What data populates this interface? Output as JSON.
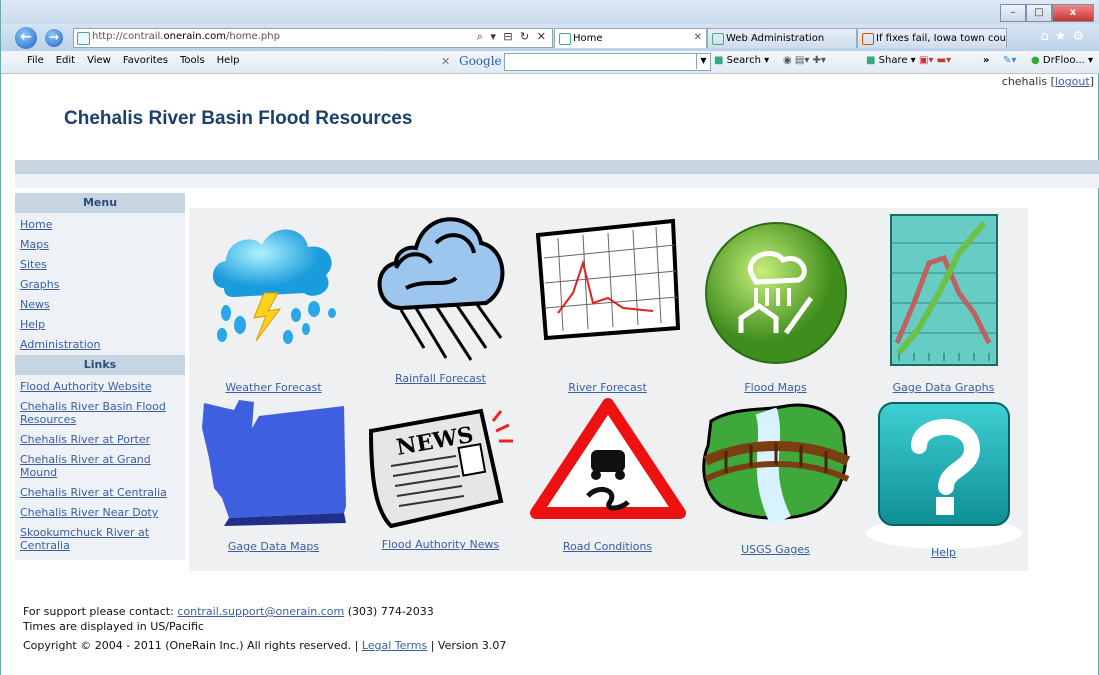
{
  "browser": {
    "address_url_prefix": "http://contrail.",
    "address_url_domain": "onerain.com",
    "address_url_path": "/home.php",
    "address_tools": "⌕ ▾ ⊟ ↻ ✕",
    "tabs": [
      {
        "label": "Home",
        "active": true
      },
      {
        "label": "Web Administration",
        "active": false
      },
      {
        "label": "If fixes fail, Iowa town coul...",
        "active": false
      }
    ],
    "menu": [
      "File",
      "Edit",
      "View",
      "Favorites",
      "Tools",
      "Help"
    ],
    "google_label": "Google",
    "toolbar": {
      "search": "Search ▾",
      "share": "Share ▾",
      "more": "»",
      "dirfloo": "DrFloo... ▾"
    },
    "window_buttons": [
      "–",
      "□",
      "x"
    ]
  },
  "page": {
    "username": "chehalis",
    "logout_label": "logout",
    "title": "Chehalis River Basin Flood Resources",
    "menu_heading": "Menu",
    "menu_items": [
      "Home",
      "Maps",
      "Sites",
      "Graphs",
      "News",
      "Help",
      "Administration"
    ],
    "links_heading": "Links",
    "links": [
      "Flood Authority Website",
      "Chehalis River Basin Flood Resources",
      "Chehalis River at Porter",
      "Chehalis River at Grand Mound",
      "Chehalis River at Centralia",
      "Chehalis River Near Doty",
      "Skookumchuck River at Centralia"
    ],
    "tiles": [
      "Weather Forecast",
      "Rainfall Forecast",
      "River Forecast",
      "Flood Maps",
      "Gage Data Graphs",
      "Gage Data Maps",
      "Flood Authority News",
      "Road Conditions",
      "USGS Gages",
      "Help"
    ],
    "news_word": "NEWS",
    "footer": {
      "support_text": "For support please contact:",
      "support_email": "contrail.support@onerain.com",
      "support_phone": "(303) 774-2033",
      "timezone": "Times are displayed in US/Pacific",
      "copyright": "Copyright © 2004 - 2011 (OneRain Inc.) All rights reserved. |",
      "legal_label": "Legal Terms",
      "version": "| Version 3.07"
    }
  },
  "colors": {
    "title": "#1d3f6d",
    "link": "#3c5ea0",
    "bar": "#c7d4e2"
  }
}
